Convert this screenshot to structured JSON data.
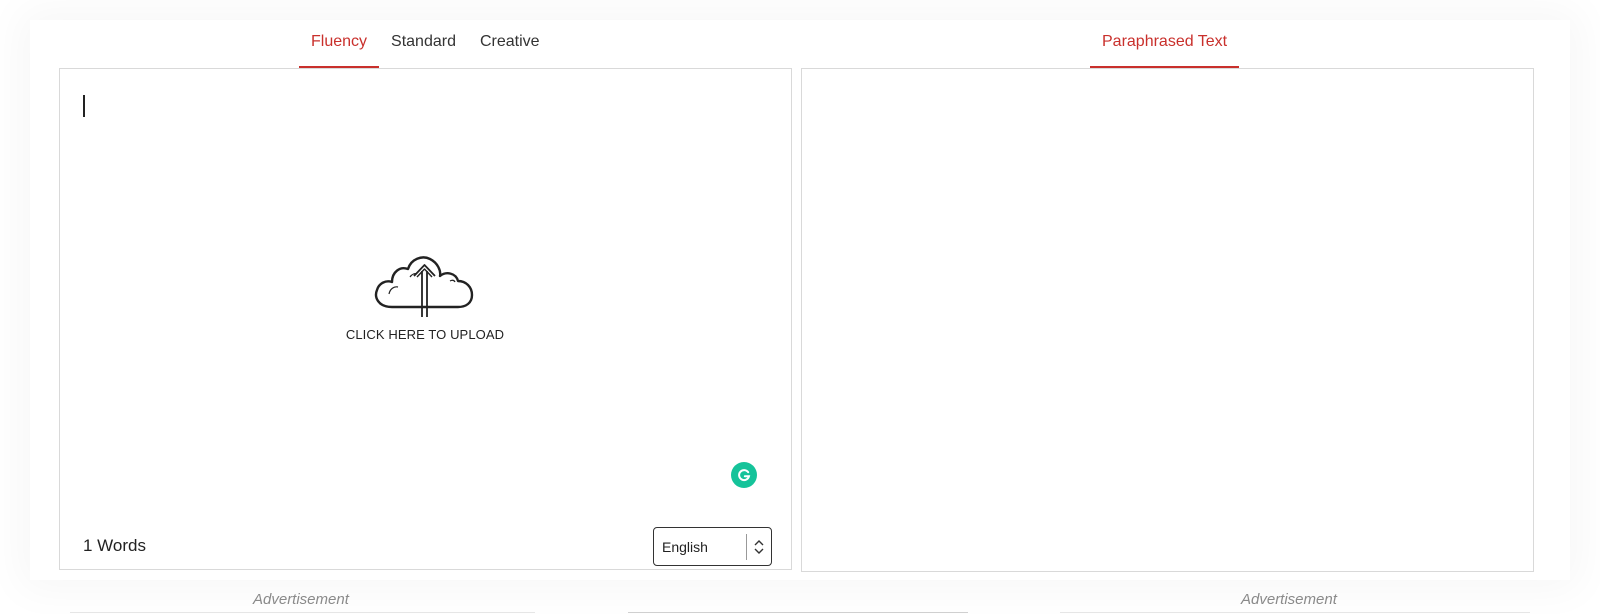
{
  "input_tabs": [
    {
      "label": "Fluency",
      "active": true
    },
    {
      "label": "Standard",
      "active": false
    },
    {
      "label": "Creative",
      "active": false
    }
  ],
  "output_tab": {
    "label": "Paraphrased Text",
    "active": true
  },
  "upload": {
    "label": "CLICK HERE TO UPLOAD",
    "icon": "cloud-upload-icon"
  },
  "grammarly": {
    "icon": "grammarly-icon",
    "color": "#15c39a"
  },
  "editor": {
    "word_count": "1 Words",
    "value": ""
  },
  "language": {
    "selected": "English"
  },
  "ads": {
    "left": "Advertisement",
    "right": "Advertisement"
  },
  "colors": {
    "accent": "#c9302c",
    "border": "#d9d9d9"
  }
}
